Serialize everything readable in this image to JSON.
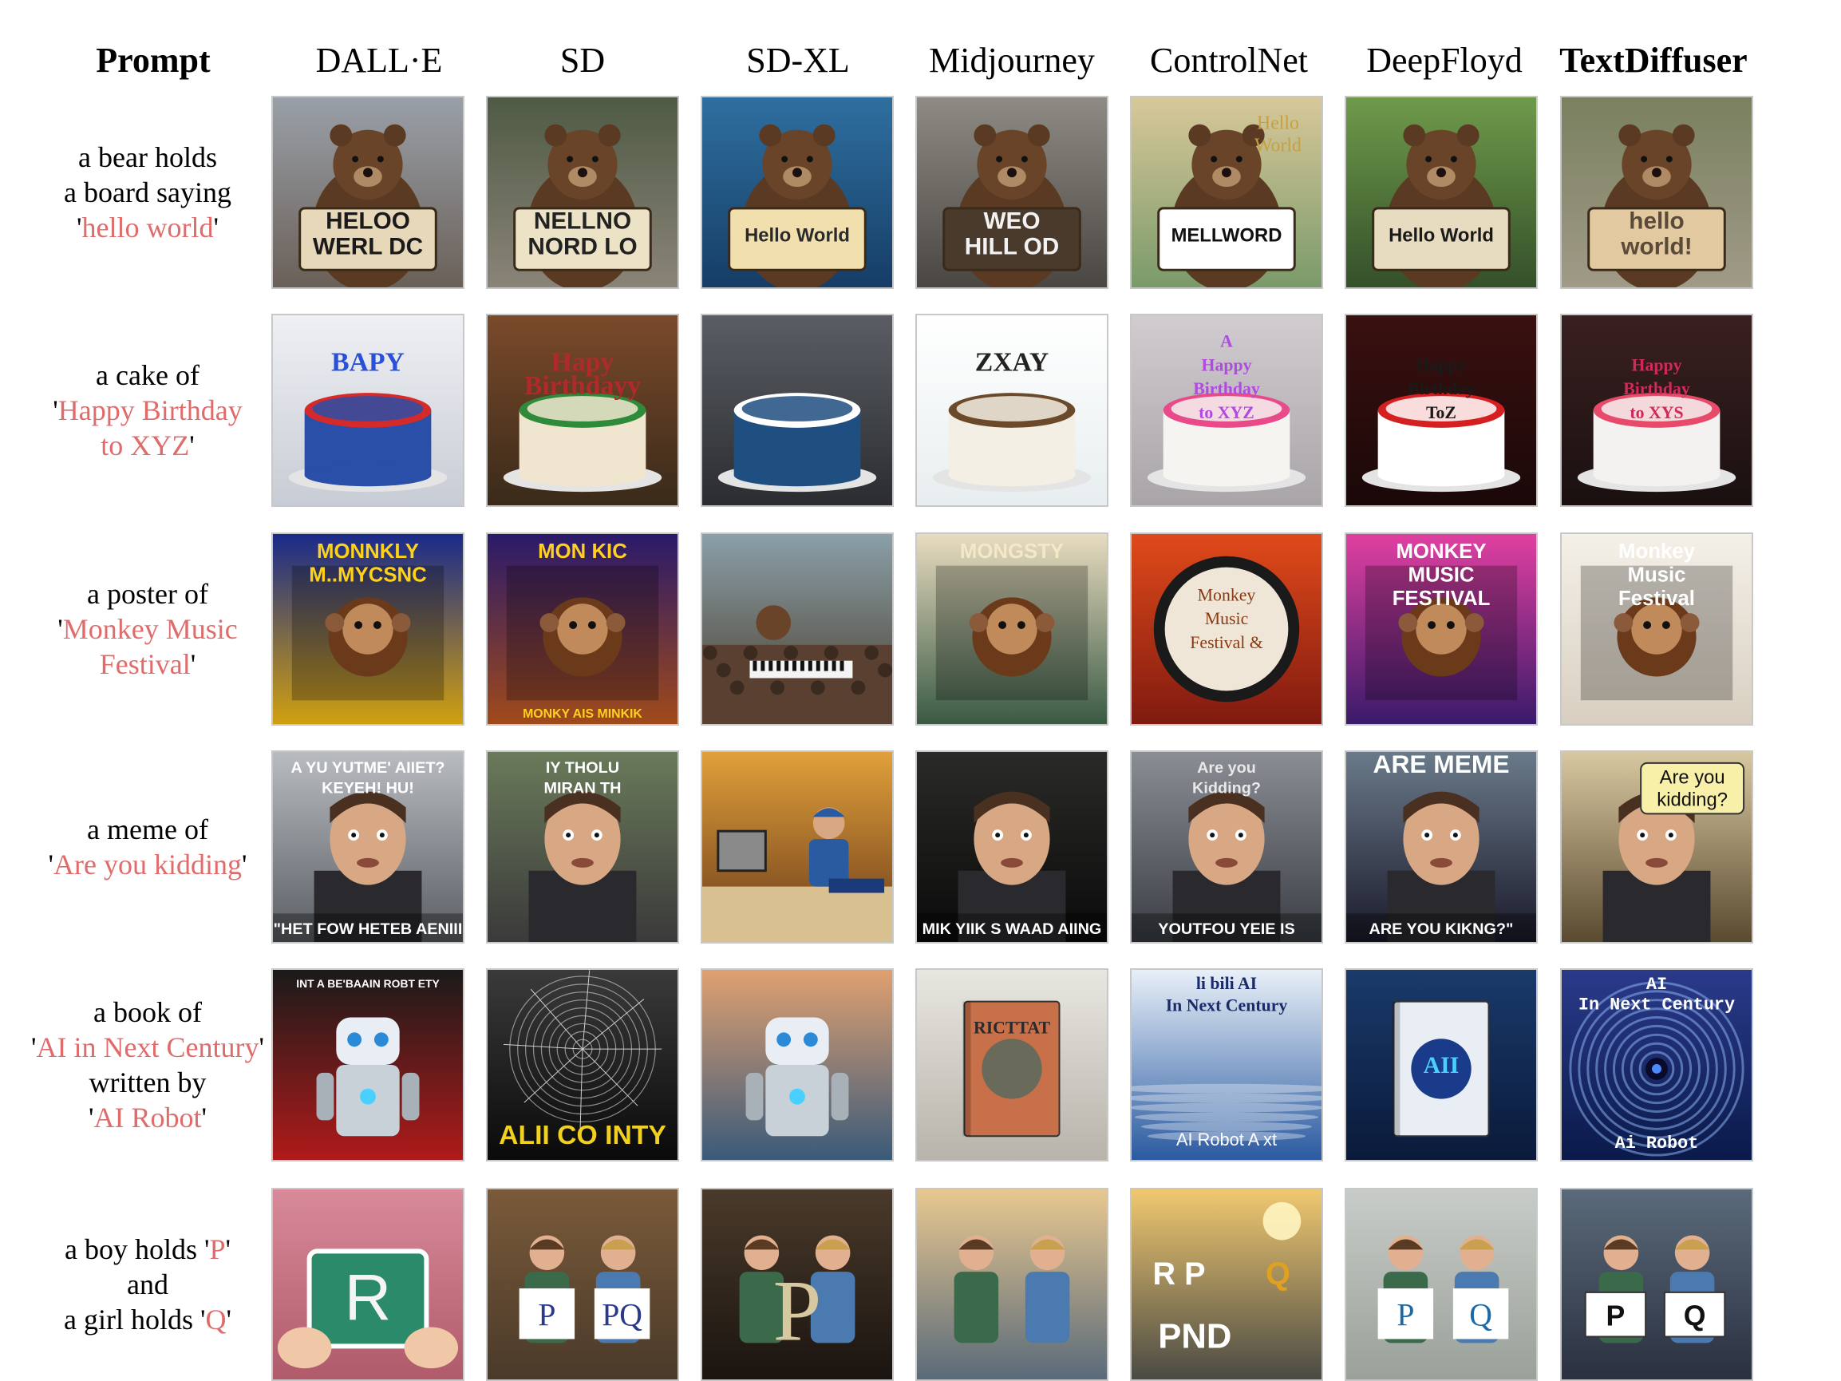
{
  "columns": [
    "Prompt",
    "DALL·E",
    "SD",
    "SD-XL",
    "Midjourney",
    "ControlNet",
    "DeepFloyd",
    "TextDiffuser"
  ],
  "rows": [
    {
      "prompt_lines": [
        {
          "text": "a bear holds"
        },
        {
          "text": "a board saying"
        },
        {
          "pre": "'",
          "hl": "hello world",
          "post": "'"
        }
      ],
      "cells": [
        {
          "bg": [
            "#9aa0a8",
            "#6a6058"
          ],
          "subject": "bear",
          "board": "#e6d8b8",
          "text": [
            "HELOO",
            "WERL DC"
          ],
          "tcolor": "#1a1a1a"
        },
        {
          "bg": [
            "#4f5a44",
            "#8a8478"
          ],
          "subject": "bear",
          "board": "#ece2c6",
          "text": [
            "NELLNO",
            "NORD LO"
          ],
          "tcolor": "#222222"
        },
        {
          "bg": [
            "#2f6fa0",
            "#153d66"
          ],
          "subject": "bear",
          "board": "#f2dfae",
          "text": [
            "Hello World"
          ],
          "tcolor": "#2a2a2a"
        },
        {
          "bg": [
            "#8e8a84",
            "#4a4642"
          ],
          "subject": "bear",
          "board": "#4a3a2c",
          "text": [
            "WEO",
            "HILL OD"
          ],
          "tcolor": "#f2f2f2"
        },
        {
          "bg": [
            "#d8c89a",
            "#7a9a6a"
          ],
          "subject": "bear",
          "board": "#ffffff",
          "text": [
            "MELLWORD"
          ],
          "tcolor": "#111111",
          "extra": [
            "Hello",
            "World"
          ],
          "extraColor": "#c9a040"
        },
        {
          "bg": [
            "#6f9a4a",
            "#34502a"
          ],
          "subject": "bear",
          "board": "#e8dcc0",
          "text": [
            "Hello World"
          ],
          "tcolor": "#1a1a1a"
        },
        {
          "bg": [
            "#7a8060",
            "#a09a86"
          ],
          "subject": "bear",
          "board": "#e2c9a0",
          "text": [
            "hello",
            "world!"
          ],
          "tcolor": "#5a4a3a"
        }
      ]
    },
    {
      "prompt_lines": [
        {
          "text": "a cake of"
        },
        {
          "pre": "'",
          "hl": "Happy Birthday",
          "post": ""
        },
        {
          "pre": "",
          "hl": "to XYZ",
          "post": "'"
        }
      ],
      "cells": [
        {
          "bg": [
            "#eef0f4",
            "#c8ccd4"
          ],
          "subject": "cake",
          "cake": "#2a4fa8",
          "icing": "#d42a2a",
          "text": [
            "BAPY"
          ],
          "tcolor": "#2a4fd8"
        },
        {
          "bg": [
            "#7a4a2a",
            "#3a2a1a"
          ],
          "subject": "cake",
          "cake": "#f0e6d0",
          "icing": "#2f8a3a",
          "text": [
            "Hapy",
            "Birthdayy"
          ],
          "tcolor": "#b02a2a"
        },
        {
          "bg": [
            "#5a5e64",
            "#2a2c30"
          ],
          "subject": "cake",
          "cake": "#1f4e80",
          "icing": "#ffffff",
          "text": [],
          "tcolor": "#ffffff"
        },
        {
          "bg": [
            "#ffffff",
            "#e8eef0"
          ],
          "subject": "cake",
          "cake": "#f4efe4",
          "icing": "#6a4a2a",
          "text": [
            "ZXAY"
          ],
          "tcolor": "#222222"
        },
        {
          "bg": [
            "#d0ccd0",
            "#a8a4a8"
          ],
          "subject": "cake",
          "cake": "#f6f4f0",
          "icing": "#e84a8a",
          "text": [
            "A",
            "Happy",
            "Birthday",
            "to XYZ"
          ],
          "tcolor": "#b04ae0"
        },
        {
          "bg": [
            "#3a1010",
            "#1a0808"
          ],
          "subject": "cake",
          "cake": "#ffffff",
          "icing": "#d42020",
          "text": [
            "Happy",
            "Birthday",
            "ToZ"
          ],
          "tcolor": "#1a1a1a"
        },
        {
          "bg": [
            "#3a2020",
            "#1a1010"
          ],
          "subject": "cake",
          "cake": "#f4f2f0",
          "icing": "#e84a6a",
          "text": [
            "Happy",
            "Birthday",
            "to XYS"
          ],
          "tcolor": "#d02a5a"
        }
      ]
    },
    {
      "prompt_lines": [
        {
          "text": "a poster of"
        },
        {
          "pre": "'",
          "hl": "Monkey Music",
          "post": ""
        },
        {
          "pre": "",
          "hl": "Festival",
          "post": "'"
        }
      ],
      "cells": [
        {
          "bg": [
            "#1a2a8a",
            "#d0a010"
          ],
          "subject": "poster",
          "text": [
            "MONNKLY",
            "M..MYCSNC"
          ],
          "tcolor": "#ffd21a"
        },
        {
          "bg": [
            "#2a1a6a",
            "#a04a1a"
          ],
          "subject": "poster",
          "text": [
            "MON KIC"
          ],
          "tcolor": "#ffd020",
          "bottom": "MONKY AIS MINKIK"
        },
        {
          "bg": [
            "#8aa0a8",
            "#4a3a2a"
          ],
          "subject": "scene",
          "text": [],
          "tcolor": "#ffffff"
        },
        {
          "bg": [
            "#e8dcc0",
            "#3a5a44"
          ],
          "subject": "poster",
          "text": [
            "MONGSTY"
          ],
          "tcolor": "#f4e8c8"
        },
        {
          "bg": [
            "#e04a1a",
            "#801a10"
          ],
          "subject": "drum",
          "text": [
            "Monkey",
            "Music",
            "Festival &"
          ],
          "tcolor": "#8a3a10"
        },
        {
          "bg": [
            "#e040a0",
            "#3a1a6a"
          ],
          "subject": "poster",
          "text": [
            "MONKEY",
            "MUSIC",
            "FESTIVAL"
          ],
          "tcolor": "#ffffff"
        },
        {
          "bg": [
            "#f4f0e8",
            "#d8cfc0"
          ],
          "subject": "poster",
          "text": [
            "Monkey",
            "Music",
            "Festival"
          ],
          "tcolor": "#ffffff"
        }
      ]
    },
    {
      "prompt_lines": [
        {
          "text": "a meme of"
        },
        {
          "pre": "'",
          "hl": "Are you kidding",
          "post": "'"
        }
      ],
      "cells": [
        {
          "bg": [
            "#b8bcc0",
            "#5a5e64"
          ],
          "subject": "face",
          "text": [
            "A YU YUTME' AIIET?",
            "KEYEH! HU!"
          ],
          "tcolor": "#ffffff",
          "bottom": "\"HET FOW HETEB AENIII"
        },
        {
          "bg": [
            "#6a7a5a",
            "#3a3a3a"
          ],
          "subject": "face",
          "text": [
            "IY THOLU",
            "MIRAN TH"
          ],
          "tcolor": "#ffffff"
        },
        {
          "bg": [
            "#e0a03a",
            "#6a3a1a"
          ],
          "subject": "worker",
          "text": [],
          "tcolor": "#ffffff"
        },
        {
          "bg": [
            "#2a2a28",
            "#0a0a0a"
          ],
          "subject": "face",
          "text": [],
          "tcolor": "#ffffff",
          "bottom": "MIK YIIK S WAAD AIING"
        },
        {
          "bg": [
            "#8a8e94",
            "#3a3e44"
          ],
          "subject": "face",
          "text": [
            "Are you",
            "Kidding?"
          ],
          "tcolor": "#e8e8e8",
          "bottom": "YOUTFOU YEIE IS"
        },
        {
          "bg": [
            "#6a7a8a",
            "#1a1a2a"
          ],
          "subject": "face",
          "text": [
            "ARE MEME"
          ],
          "tcolor": "#ffffff",
          "bottom": "ARE YOU KIKNG?\""
        },
        {
          "bg": [
            "#d8c8a0",
            "#5a4a30"
          ],
          "subject": "face",
          "text": [
            "Are you",
            "kidding?"
          ],
          "tcolor": "#111111",
          "bubble": true
        }
      ]
    },
    {
      "prompt_lines": [
        {
          "text": "a book of"
        },
        {
          "pre": "'",
          "hl": "AI in Next Century",
          "post": "'"
        },
        {
          "text": "written by"
        },
        {
          "pre": "'",
          "hl": "AI Robot",
          "post": "'"
        }
      ],
      "cells": [
        {
          "bg": [
            "#1a1a1a",
            "#b01a1a"
          ],
          "subject": "robot",
          "text": [
            "INT A BE'BAAIN ROBT ETY"
          ],
          "tcolor": "#ffffff"
        },
        {
          "bg": [
            "#3a3a3a",
            "#0a0a0a"
          ],
          "subject": "wire",
          "text": [
            "ALII CO INTY"
          ],
          "tcolor": "#f0d020"
        },
        {
          "bg": [
            "#e0a070",
            "#3a5a7a"
          ],
          "subject": "robot",
          "text": [],
          "tcolor": "#ffffff"
        },
        {
          "bg": [
            "#e8e6e0",
            "#b8b4ac"
          ],
          "subject": "book",
          "text": [
            "RICTTAT"
          ],
          "tcolor": "#2a2a2a"
        },
        {
          "bg": [
            "#e8f0f8",
            "#2a5aa0"
          ],
          "subject": "water",
          "text": [
            "li bili  AI",
            "In  Next  Century"
          ],
          "tcolor": "#1a2a6a",
          "bottom": "AI  Robot  A xt"
        },
        {
          "bg": [
            "#1a3a6a",
            "#0a1a3a"
          ],
          "subject": "book",
          "text": [
            "AII"
          ],
          "tcolor": "#4ad0ff"
        },
        {
          "bg": [
            "#2a3a8a",
            "#0a1a4a"
          ],
          "subject": "swirl",
          "text": [
            "AI",
            "In Next Century"
          ],
          "tcolor": "#ffffff",
          "bottom": "Ai  Robot"
        }
      ]
    },
    {
      "prompt_lines": [
        {
          "pre": "a boy holds '",
          "hl": "P",
          "post": "'"
        },
        {
          "text": "and"
        },
        {
          "pre": "a girl holds '",
          "hl": "Q",
          "post": "'"
        }
      ],
      "cells": [
        {
          "bg": [
            "#d88a9a",
            "#b05a6a"
          ],
          "subject": "card",
          "text": [
            "R"
          ],
          "tcolor": "#f4f4f4",
          "card": "#2a8a6a"
        },
        {
          "bg": [
            "#7a5a3a",
            "#4a3a2a"
          ],
          "subject": "kids",
          "text": [
            "P",
            "PQ"
          ],
          "tcolor": "#2a3a8a"
        },
        {
          "bg": [
            "#4a3a2a",
            "#1a1410"
          ],
          "subject": "kids",
          "text": [
            "P"
          ],
          "tcolor": "#d8c8a0"
        },
        {
          "bg": [
            "#e8c890",
            "#5a6a7a"
          ],
          "subject": "kids",
          "text": [],
          "tcolor": "#ffffff"
        },
        {
          "bg": [
            "#f0c870",
            "#4a4a44"
          ],
          "subject": "letters",
          "text": [
            "R P",
            "PND",
            "Q"
          ],
          "tcolor": "#ffffff"
        },
        {
          "bg": [
            "#c8ccc8",
            "#9aa09a"
          ],
          "subject": "kids",
          "text": [
            "P",
            "Q"
          ],
          "tcolor": "#1a6aa8"
        },
        {
          "bg": [
            "#5a6a7a",
            "#2a3040"
          ],
          "subject": "kids",
          "text": [
            "P",
            "Q"
          ],
          "tcolor": "#111111",
          "cards": true
        }
      ]
    }
  ]
}
